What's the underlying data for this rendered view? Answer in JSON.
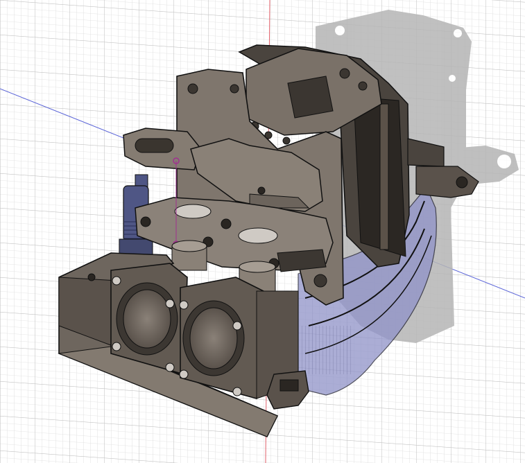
{
  "app": {
    "view": "cad-3d-viewport",
    "background_color": "#ffffff",
    "grid_minor_color": "#dcdcdc",
    "grid_major_color": "#c4c4c4",
    "axis_x_color": "#5a64d8",
    "axis_z_color": "#e0606a",
    "body_color": "#7a7168",
    "body_dark_color": "#4a443e",
    "edge_color": "#111111",
    "cable_guide_color": "#8f92c8",
    "fitting_color": "#4f5685",
    "shadow_color": "#b8b8b8",
    "sketch_point_color": "#a03090"
  },
  "scene": {
    "model": "extruder-assembly",
    "fans": [
      {
        "id": "fan-left"
      },
      {
        "id": "fan-right"
      }
    ]
  }
}
